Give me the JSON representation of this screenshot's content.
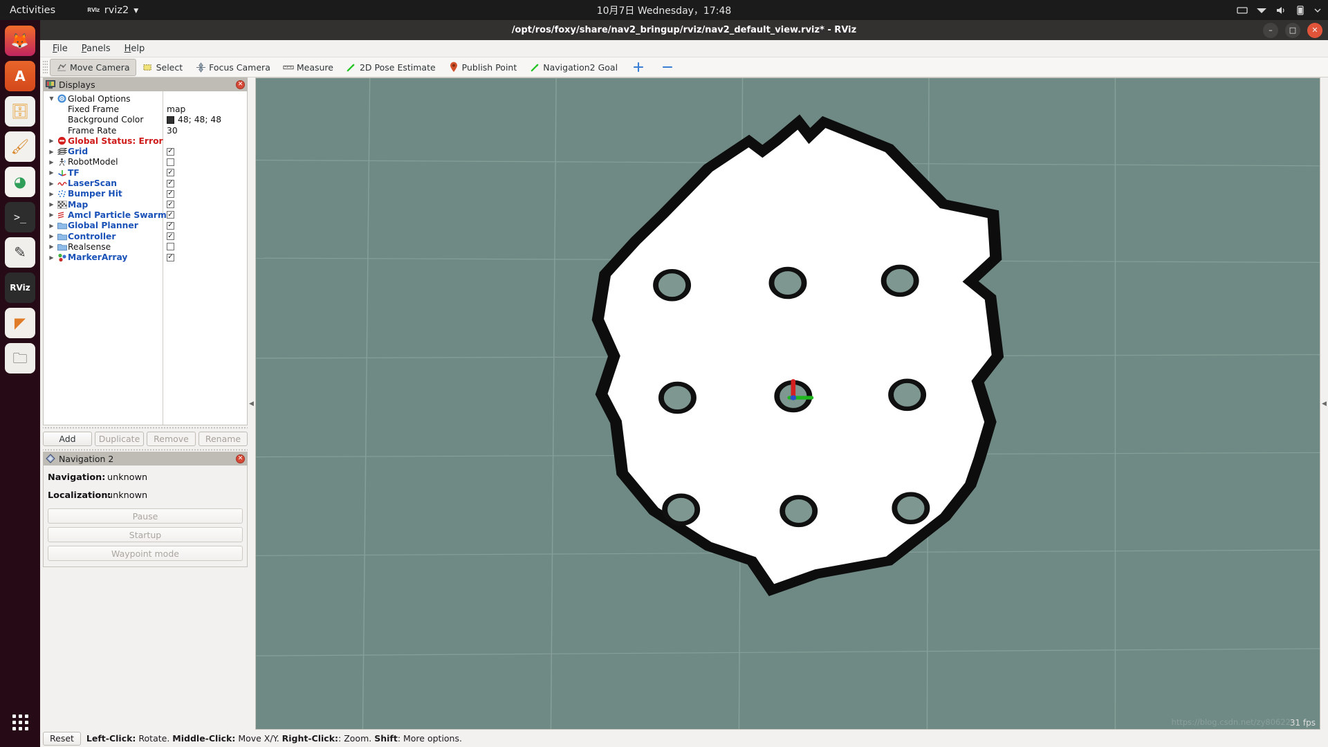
{
  "desktop": {
    "activities_label": "Activities",
    "app_menu": {
      "icon": "rviz-icon",
      "name": "rviz2",
      "caret": "▼"
    },
    "clock": "10月7日 Wednesday，17:48",
    "tray_icons": [
      "screen-icon",
      "network-icon",
      "volume-icon",
      "battery-icon",
      "power-menu-icon"
    ],
    "dock_items": [
      {
        "name": "firefox",
        "glyph": "🦊",
        "bg": "#e0513b"
      },
      {
        "name": "ubuntu-software",
        "glyph": "A",
        "bg": "#dd5b20"
      },
      {
        "name": "files",
        "glyph": "📁",
        "bg": "#e8a33d"
      },
      {
        "name": "help",
        "glyph": "🖌",
        "bg": "#e8e4de"
      },
      {
        "name": "unknown-app",
        "glyph": "◕",
        "bg": "#2f8a4e"
      },
      {
        "name": "terminal",
        "glyph": ">_",
        "bg": "#2c2c2c"
      },
      {
        "name": "text-editor",
        "glyph": "✎",
        "bg": "#e4e1dc"
      },
      {
        "name": "rviz",
        "glyph": "RViz",
        "bg": "#2b2b2b"
      },
      {
        "name": "vlc-or-folder",
        "glyph": "◤",
        "bg": "#e07b28"
      },
      {
        "name": "nautilus",
        "glyph": "🗀",
        "bg": "#e8e4de"
      }
    ],
    "apps_button": "show-applications"
  },
  "window": {
    "title": "/opt/ros/foxy/share/nav2_bringup/rviz/nav2_default_view.rviz* - RViz",
    "controls": {
      "minimize": "–",
      "maximize": "□",
      "close": "✕"
    }
  },
  "menubar": [
    {
      "label": "File",
      "mnemonic": "F"
    },
    {
      "label": "Panels",
      "mnemonic": "P"
    },
    {
      "label": "Help",
      "mnemonic": "H"
    }
  ],
  "toolbar": {
    "tools": [
      {
        "label": "Move Camera",
        "icon": "move-camera-icon",
        "active": true
      },
      {
        "label": "Select",
        "icon": "select-icon",
        "active": false
      },
      {
        "label": "Focus Camera",
        "icon": "focus-camera-icon",
        "active": false
      },
      {
        "label": "Measure",
        "icon": "ruler-icon",
        "active": false
      },
      {
        "label": "2D Pose Estimate",
        "icon": "pose-arrow-icon",
        "active": false
      },
      {
        "label": "Publish Point",
        "icon": "map-pin-icon",
        "active": false
      },
      {
        "label": "Navigation2 Goal",
        "icon": "goal-arrow-icon",
        "active": false
      }
    ],
    "add_tool_label": "+",
    "remove_tool_label": "–"
  },
  "displays_panel": {
    "header": "Displays",
    "close_label": "✕",
    "rows": [
      {
        "indent": 0,
        "twist": "▼",
        "icon": "gear-icon",
        "label": "Global Options",
        "style": "plain",
        "value_type": "none"
      },
      {
        "indent": 1,
        "twist": "",
        "icon": "none",
        "label": "Fixed Frame",
        "style": "plain",
        "value_type": "text",
        "value": "map"
      },
      {
        "indent": 1,
        "twist": "",
        "icon": "none",
        "label": "Background Color",
        "style": "plain",
        "value_type": "color",
        "value": "48; 48; 48",
        "swatch": "#303030"
      },
      {
        "indent": 1,
        "twist": "",
        "icon": "none",
        "label": "Frame Rate",
        "style": "plain",
        "value_type": "text",
        "value": "30"
      },
      {
        "indent": 0,
        "twist": "▶",
        "icon": "error-icon",
        "label": "Global Status: Error",
        "style": "err",
        "value_type": "none"
      },
      {
        "indent": 0,
        "twist": "▶",
        "icon": "grid-icon",
        "label": "Grid",
        "style": "link",
        "value_type": "check",
        "checked": true
      },
      {
        "indent": 0,
        "twist": "▶",
        "icon": "robot-icon",
        "label": "RobotModel",
        "style": "plain",
        "value_type": "check",
        "checked": false
      },
      {
        "indent": 0,
        "twist": "▶",
        "icon": "tf-icon",
        "label": "TF",
        "style": "link",
        "value_type": "check",
        "checked": true
      },
      {
        "indent": 0,
        "twist": "▶",
        "icon": "laserscan-icon",
        "label": "LaserScan",
        "style": "link",
        "value_type": "check",
        "checked": true
      },
      {
        "indent": 0,
        "twist": "▶",
        "icon": "pointcloud-icon",
        "label": "Bumper Hit",
        "style": "link",
        "value_type": "check",
        "checked": true
      },
      {
        "indent": 0,
        "twist": "▶",
        "icon": "map-icon",
        "label": "Map",
        "style": "link",
        "value_type": "check",
        "checked": true
      },
      {
        "indent": 0,
        "twist": "▶",
        "icon": "posearray-icon",
        "label": "Amcl Particle Swarm",
        "style": "link",
        "value_type": "check",
        "checked": true
      },
      {
        "indent": 0,
        "twist": "▶",
        "icon": "folder-icon",
        "label": "Global Planner",
        "style": "link",
        "value_type": "check",
        "checked": true
      },
      {
        "indent": 0,
        "twist": "▶",
        "icon": "folder-icon",
        "label": "Controller",
        "style": "link",
        "value_type": "check",
        "checked": true
      },
      {
        "indent": 0,
        "twist": "▶",
        "icon": "folder-icon",
        "label": "Realsense",
        "style": "plain",
        "value_type": "check",
        "checked": false
      },
      {
        "indent": 0,
        "twist": "▶",
        "icon": "markerarray-icon",
        "label": "MarkerArray",
        "style": "link",
        "value_type": "check",
        "checked": true
      }
    ],
    "buttons": [
      {
        "label": "Add",
        "enabled": true
      },
      {
        "label": "Duplicate",
        "enabled": false
      },
      {
        "label": "Remove",
        "enabled": false
      },
      {
        "label": "Rename",
        "enabled": false
      }
    ]
  },
  "nav2_panel": {
    "header": "Navigation 2",
    "close_label": "✕",
    "status": [
      {
        "key": "Navigation:",
        "value": "unknown"
      },
      {
        "key": "Localization:",
        "value": "unknown"
      }
    ],
    "buttons": [
      {
        "label": "Pause",
        "enabled": false
      },
      {
        "label": "Startup",
        "enabled": false
      },
      {
        "label": "Waypoint mode",
        "enabled": false
      }
    ]
  },
  "viewport": {
    "background_color": "#6f8a84",
    "grid_color": "#8ba39e",
    "map_free_color": "#ffffff",
    "map_wall_color": "#0d0d0d",
    "obstacle_color": "#7e9791",
    "fps": "31 fps",
    "watermark": "https://blog.csdn.net/zy80622",
    "collapse_left": "◀",
    "collapse_right": "◀"
  },
  "statusbar": {
    "reset_label": "Reset",
    "hint_parts": [
      {
        "text": "Left-Click:",
        "bold": true
      },
      {
        "text": " Rotate. ",
        "bold": false
      },
      {
        "text": "Middle-Click:",
        "bold": true
      },
      {
        "text": " Move X/Y. ",
        "bold": false
      },
      {
        "text": "Right-Click:",
        "bold": true
      },
      {
        "text": ": Zoom. ",
        "bold": false
      },
      {
        "text": "Shift",
        "bold": true
      },
      {
        "text": ": More options.",
        "bold": false
      }
    ]
  }
}
